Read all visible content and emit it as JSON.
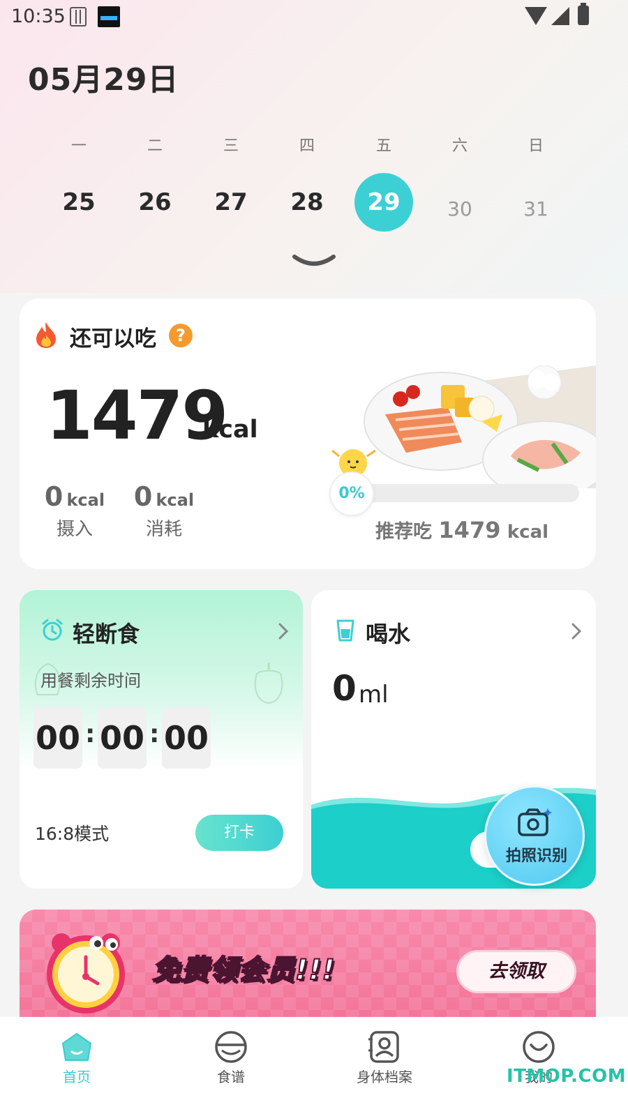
{
  "status_bar": {
    "time": "10:35"
  },
  "header": {
    "date": "05月29日"
  },
  "week": [
    {
      "weekday": "一",
      "day": "25",
      "state": "past"
    },
    {
      "weekday": "二",
      "day": "26",
      "state": "past"
    },
    {
      "weekday": "三",
      "day": "27",
      "state": "past"
    },
    {
      "weekday": "四",
      "day": "28",
      "state": "past"
    },
    {
      "weekday": "五",
      "day": "29",
      "state": "active"
    },
    {
      "weekday": "六",
      "day": "30",
      "state": "future"
    },
    {
      "weekday": "日",
      "day": "31",
      "state": "future"
    }
  ],
  "calorie": {
    "title": "还可以吃",
    "help": "?",
    "remaining": "1479",
    "unit": "kcal",
    "intake_value": "0",
    "intake_unit": "kcal",
    "intake_label": "摄入",
    "burn_value": "0",
    "burn_unit": "kcal",
    "burn_label": "消耗",
    "progress_text": "0%",
    "progress": 0,
    "recommend_prefix": "推荐吃",
    "recommend_value": "1479",
    "recommend_unit": "kcal"
  },
  "fasting": {
    "title": "轻断食",
    "subtitle": "用餐剩余时间",
    "hours": "00",
    "minutes": "00",
    "seconds": "00",
    "colon": ":",
    "mode": "16:8模式",
    "button": "打卡"
  },
  "water": {
    "title": "喝水",
    "value": "0",
    "unit": "ml"
  },
  "photo": {
    "label": "拍照识别"
  },
  "banner": {
    "text": "免费领会员!!!",
    "button": "去领取"
  },
  "nav": [
    {
      "label": "首页",
      "icon": "home-icon",
      "active": true
    },
    {
      "label": "食谱",
      "icon": "bowl-icon",
      "active": false
    },
    {
      "label": "身体档案",
      "icon": "profile-icon",
      "active": false
    },
    {
      "label": "我的",
      "icon": "smile-icon",
      "active": false
    }
  ],
  "watermark": "ITMOP.COM",
  "colors": {
    "accent": "#3cd0d4",
    "fire": "#f5592f",
    "help": "#f59a2f",
    "banner": "#f47ea0"
  }
}
